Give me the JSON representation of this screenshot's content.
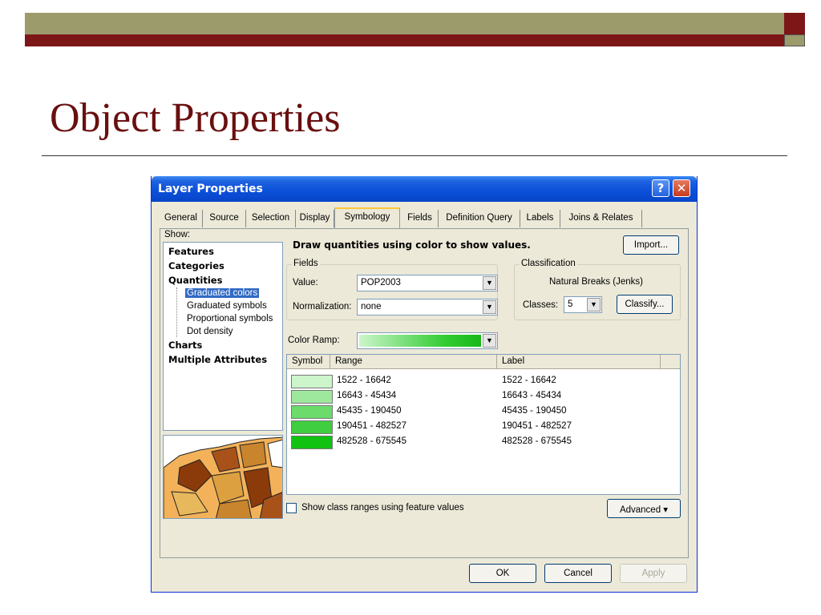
{
  "slide": {
    "title": "Object Properties"
  },
  "dialog": {
    "title": "Layer Properties",
    "help_label": "?",
    "close_label": "✕",
    "tabs": [
      {
        "label": "General"
      },
      {
        "label": "Source"
      },
      {
        "label": "Selection"
      },
      {
        "label": "Display"
      },
      {
        "label": "Symbology",
        "active": true
      },
      {
        "label": "Fields"
      },
      {
        "label": "Definition Query"
      },
      {
        "label": "Labels"
      },
      {
        "label": "Joins & Relates"
      }
    ],
    "show": {
      "label": "Show:",
      "items": {
        "features": "Features",
        "categories": "Categories",
        "quantities": "Quantities",
        "graduated_colors": "Graduated colors",
        "graduated_symbols": "Graduated symbols",
        "proportional_symbols": "Proportional symbols",
        "dot_density": "Dot density",
        "charts": "Charts",
        "multiple_attributes": "Multiple Attributes"
      },
      "selected": "Graduated colors"
    },
    "draw_label": "Draw quantities using color to show values.",
    "import_label": "Import...",
    "fields": {
      "title": "Fields",
      "value_label": "Value:",
      "value": "POP2003",
      "normalization_label": "Normalization:",
      "normalization": "none"
    },
    "classification": {
      "title": "Classification",
      "method": "Natural Breaks (Jenks)",
      "classes_label": "Classes:",
      "classes": "5",
      "classify_label": "Classify..."
    },
    "color_ramp": {
      "label": "Color Ramp:",
      "start_color": "#ccf5cc",
      "end_color": "#18b818"
    },
    "table": {
      "headers": {
        "symbol": "Symbol",
        "range": "Range",
        "label": "Label"
      },
      "rows": [
        {
          "color": "#ccf5cc",
          "range": "1522 - 16642",
          "label": "1522 - 16642"
        },
        {
          "color": "#9ee89e",
          "range": "16643 - 45434",
          "label": "16643 - 45434"
        },
        {
          "color": "#6bdb6b",
          "range": "45435 - 190450",
          "label": "45435 - 190450"
        },
        {
          "color": "#3fce3f",
          "range": "190451 - 482527",
          "label": "190451 - 482527"
        },
        {
          "color": "#12c212",
          "range": "482528 - 675545",
          "label": "482528 - 675545"
        }
      ]
    },
    "show_class_ranges_label": "Show class ranges using feature values",
    "advanced_label": "Advanced ▾",
    "buttons": {
      "ok": "OK",
      "cancel": "Cancel",
      "apply": "Apply"
    }
  }
}
